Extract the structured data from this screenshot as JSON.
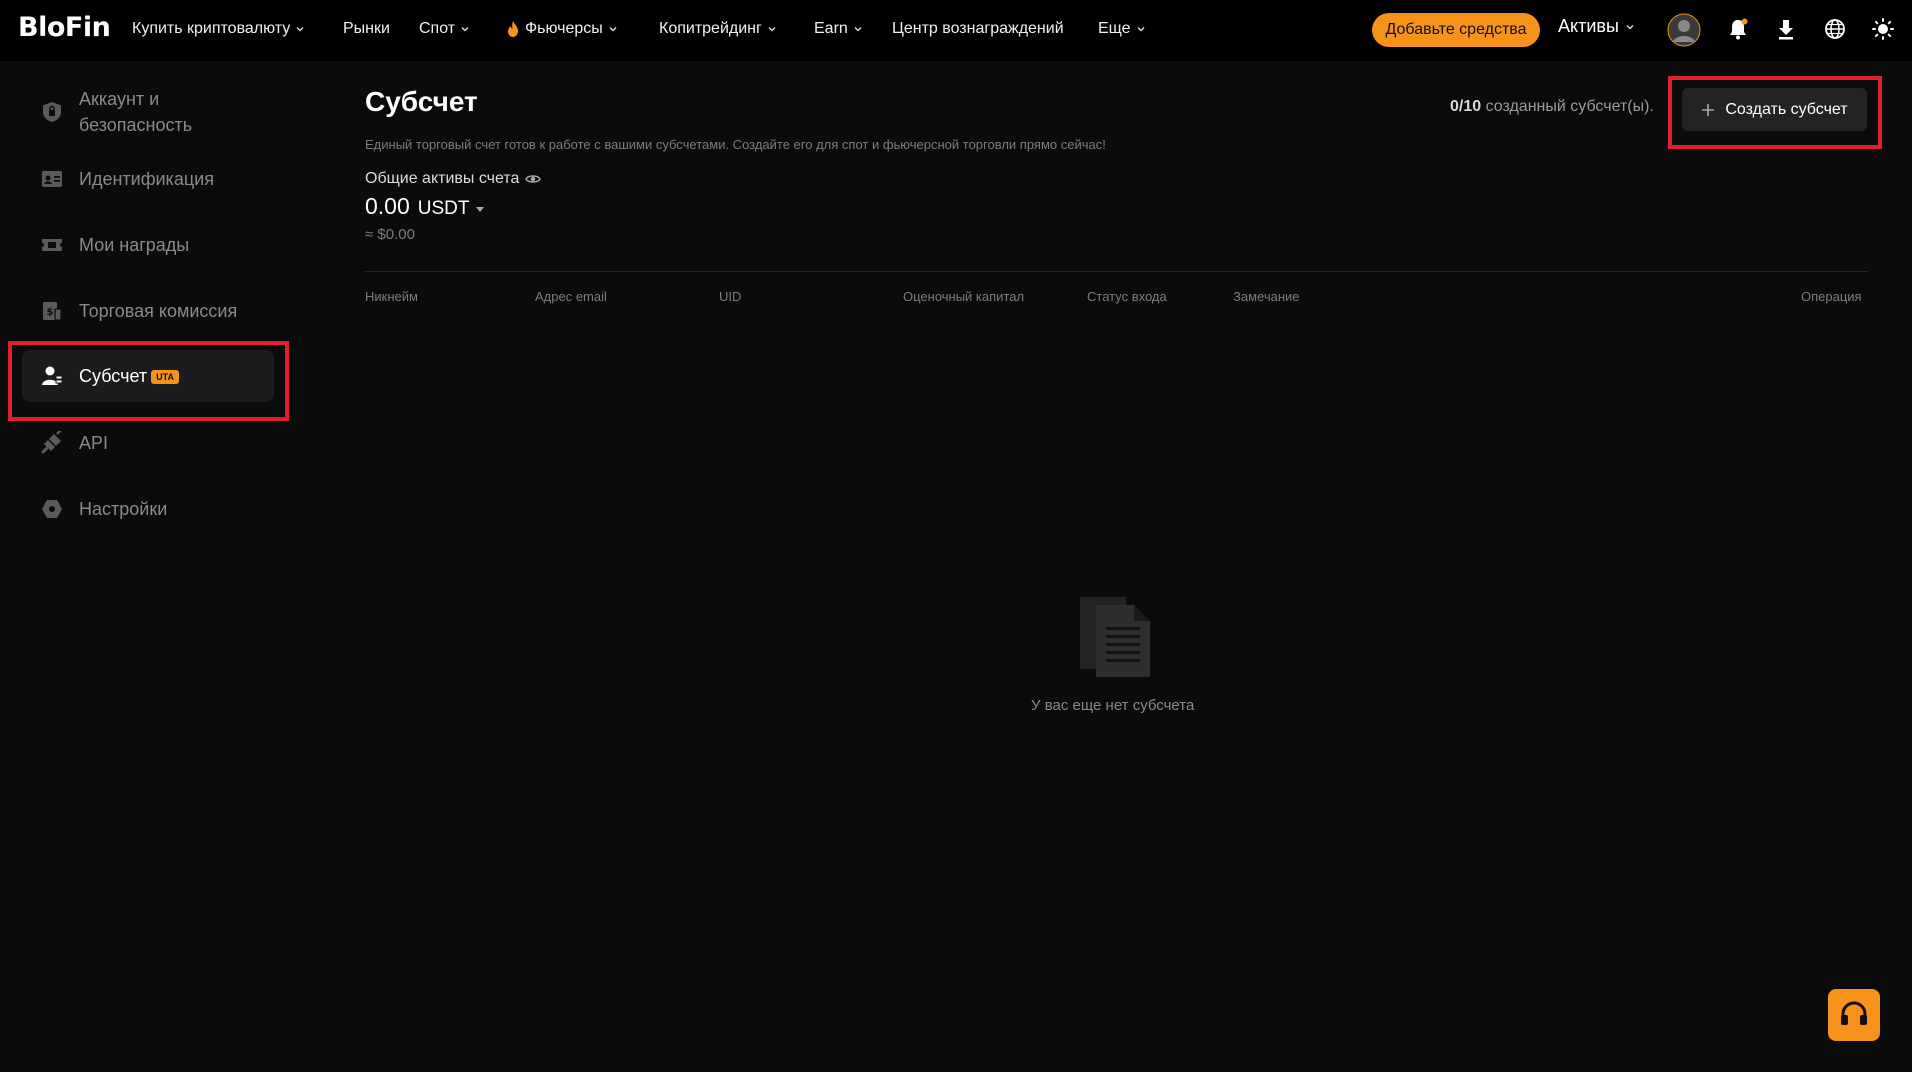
{
  "header": {
    "logo": "BloFin",
    "nav": [
      {
        "label": "Купить криптовалюту",
        "dropdown": true
      },
      {
        "label": "Рынки",
        "dropdown": false
      },
      {
        "label": "Спот",
        "dropdown": true
      },
      {
        "label": "Фьючерсы",
        "dropdown": true,
        "icon": "flame-icon"
      },
      {
        "label": "Копитрейдинг",
        "dropdown": true
      },
      {
        "label": "Earn",
        "dropdown": true
      },
      {
        "label": "Центр вознаграждений",
        "dropdown": false
      },
      {
        "label": "Еще",
        "dropdown": true
      }
    ],
    "deposit_label": "Добавьте средства",
    "assets_label": "Активы",
    "icons": [
      "avatar",
      "bell-icon",
      "download-icon",
      "globe-icon",
      "sun-icon"
    ]
  },
  "sidebar": {
    "items": [
      {
        "label": "Аккаунт и безопасность",
        "icon": "shield-icon"
      },
      {
        "label": "Идентификация",
        "icon": "id-card-icon"
      },
      {
        "label": "Мои награды",
        "icon": "ticket-icon"
      },
      {
        "label": "Торговая комиссия",
        "icon": "fee-icon"
      },
      {
        "label": "Субсчет",
        "icon": "subaccount-icon",
        "badge": "UTA",
        "active": true
      },
      {
        "label": "API",
        "icon": "api-icon"
      },
      {
        "label": "Настройки",
        "icon": "settings-icon"
      }
    ]
  },
  "main": {
    "title": "Субсчет",
    "subtitle": "Единый торговый счет готов к работе с вашими субсчетами. Создайте его для спот и фьючерсной торговли прямо сейчас!",
    "total_assets_label": "Общие активы счета",
    "balance_amount": "0.00",
    "balance_currency": "USDT",
    "balance_usd": "≈ $0.00",
    "count_value": "0/10",
    "count_suffix": " созданный субсчет(ы).",
    "create_button": "Создать субсчет",
    "table_headers": [
      "Никнейм",
      "Адрес email",
      "UID",
      "Оценочный капитал",
      "Статус входа",
      "Замечание",
      "Операция"
    ],
    "empty_text": "У вас еще нет субсчета"
  },
  "colors": {
    "accent": "#f7931a",
    "highlight": "#e0202a",
    "background": "#0b0b0b"
  }
}
